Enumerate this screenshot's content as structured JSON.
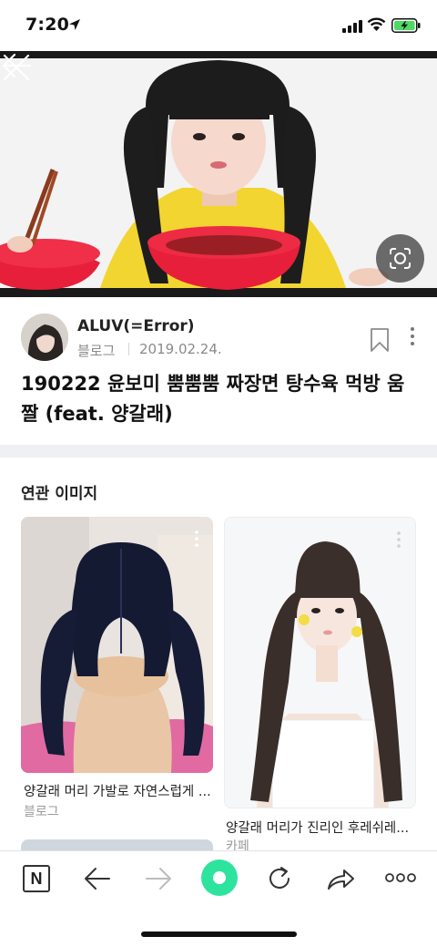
{
  "status_bar": {
    "time": "7:20"
  },
  "hero": {
    "back_icon": "arrow-left-icon",
    "close_icon": "close-icon",
    "lens_icon": "image-search-icon"
  },
  "post": {
    "author": "ALUV(=Error)",
    "source": "블로그",
    "date": "2019.02.24.",
    "title": "190222 윤보미 뿜뿜뿜 짜장면 탕수육 먹방 움짤 (feat. 양갈래)"
  },
  "related": {
    "heading": "연관 이미지",
    "items": [
      {
        "caption": "양갈래 머리 가발로 자연스럽게 ...",
        "source": "블로그"
      },
      {
        "caption": "양갈래 머리가 진리인 후레쉬레...",
        "source": "카페"
      }
    ]
  },
  "toolbar": {
    "home_label": "N",
    "colors": {
      "accent": "#2ee39e"
    }
  }
}
